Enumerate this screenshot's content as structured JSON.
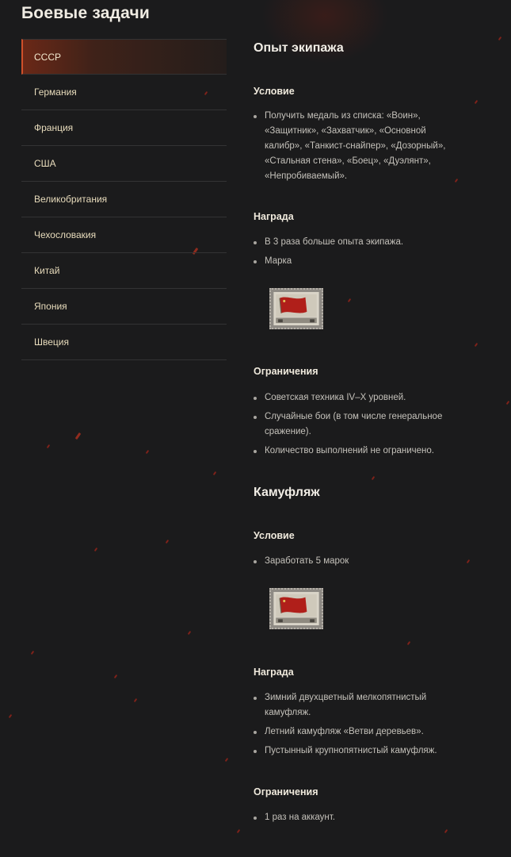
{
  "page_title": "Боевые задачи",
  "sidebar": {
    "items": [
      {
        "label": "СССР",
        "active": true
      },
      {
        "label": "Германия",
        "active": false
      },
      {
        "label": "Франция",
        "active": false
      },
      {
        "label": "США",
        "active": false
      },
      {
        "label": "Великобритания",
        "active": false
      },
      {
        "label": "Чехословакия",
        "active": false
      },
      {
        "label": "Китай",
        "active": false
      },
      {
        "label": "Япония",
        "active": false
      },
      {
        "label": "Швеция",
        "active": false
      }
    ]
  },
  "sections": [
    {
      "title": "Опыт экипажа",
      "condition_label": "Условие",
      "condition_items": [
        "Получить медаль из списка: «Воин», «Защитник», «Захватчик», «Основной калибр», «Танкист-снайпер», «Дозорный», «Стальная стена», «Боец», «Дуэлянт», «Непробиваемый»."
      ],
      "reward_label": "Награда",
      "reward_items": [
        "В 3 раза больше опыта экипажа.",
        "Марка"
      ],
      "limits_label": "Ограничения",
      "limits_items": [
        "Советская техника IV–X уровней.",
        "Случайные бои (в том числе генеральное сражение).",
        "Количество выполнений не ограничено."
      ]
    },
    {
      "title": "Камуфляж",
      "condition_label": "Условие",
      "condition_items": [
        "Заработать 5 марок"
      ],
      "reward_label": "Награда",
      "reward_items": [
        "Зимний двухцветный мелкопятнистый камуфляж.",
        "Летний камуфляж «Ветви деревьев».",
        "Пустынный крупнопятнистый камуфляж."
      ],
      "limits_label": "Ограничения",
      "limits_items": [
        "1 раз на аккаунт."
      ]
    }
  ],
  "colors": {
    "background": "#1b1b1c",
    "accent": "#d0502a",
    "nav_text": "#e8dcbc"
  }
}
